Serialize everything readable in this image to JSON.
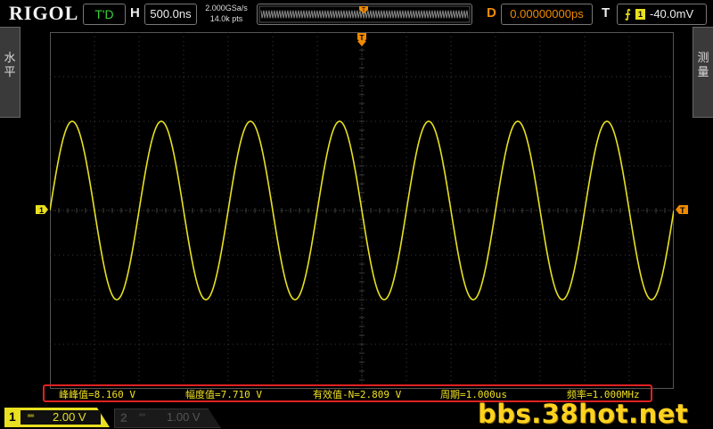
{
  "topbar": {
    "brand": "RIGOL",
    "run_status": "T'D",
    "horizontal_label": "H",
    "timebase": "500.0ns",
    "sample_rate": "2.000GSa/s",
    "memory_depth": "14.0k pts",
    "delay_label": "D",
    "delay_value": "0.00000000ps",
    "trigger_label": "T",
    "trigger_source": "1",
    "trigger_level": "-40.0mV"
  },
  "side_tabs": {
    "left": "水平",
    "right": "测量"
  },
  "waveform": {
    "color": "#e8e020",
    "cycles_visible": 7,
    "amplitude_divisions": 2.0,
    "channel_marker": "1"
  },
  "measurements": [
    {
      "label": "峰峰值=8.160 V"
    },
    {
      "label": "幅度值=7.710 V"
    },
    {
      "label": "有效值-N=2.809 V"
    },
    {
      "label": "周期=1.000us"
    },
    {
      "label": "频率=1.000MHz"
    }
  ],
  "channels": {
    "ch1": {
      "number": "1",
      "coupling": "═",
      "scale": "2.00 V",
      "color": "#e8e020"
    },
    "ch2": {
      "number": "2",
      "coupling": "═",
      "scale": "1.00 V"
    }
  },
  "watermark": "bbs.38hot.net",
  "colors": {
    "grid": "#3a3a3a",
    "trigger": "#f08a00",
    "measure_highlight": "#e02020"
  }
}
